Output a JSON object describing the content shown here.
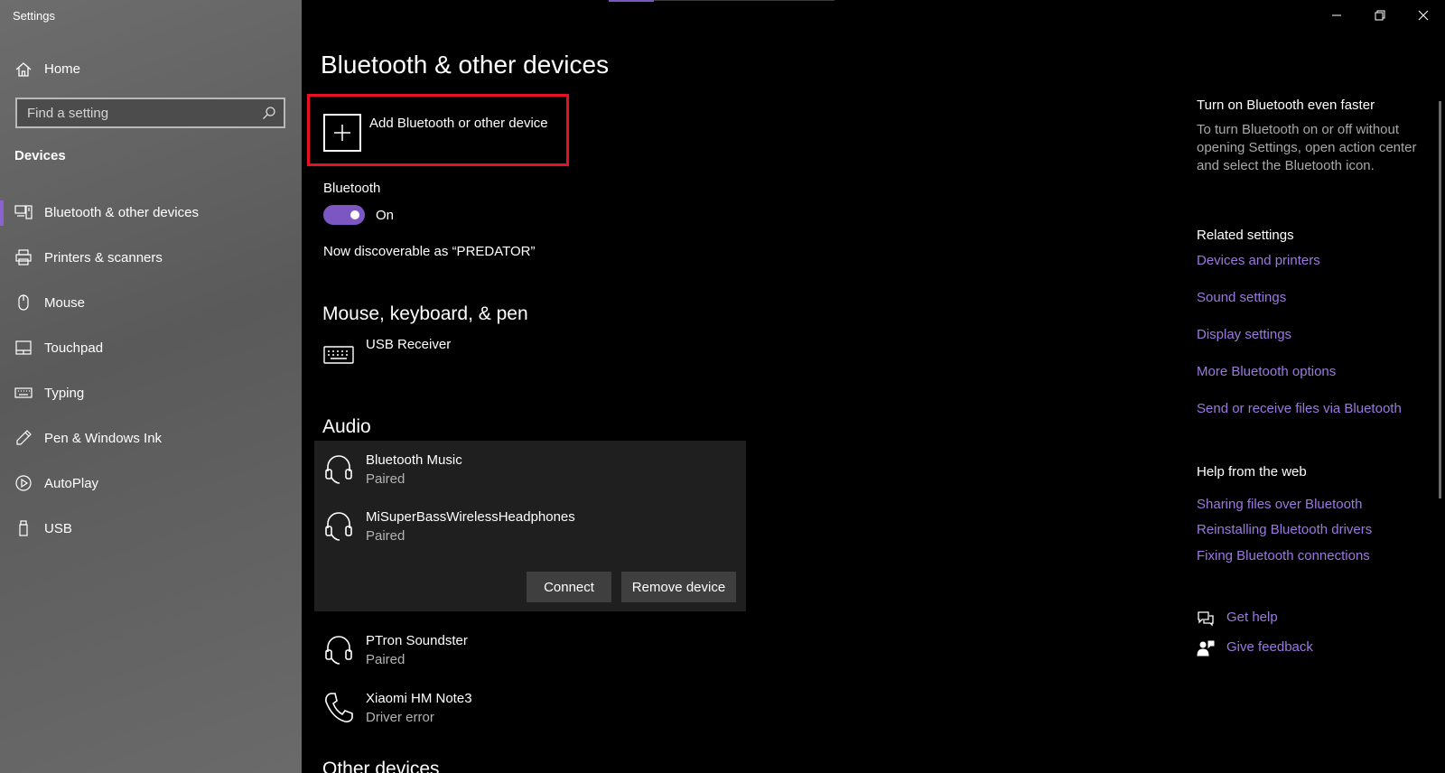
{
  "window": {
    "title": "Settings",
    "controls": [
      "minimize-icon",
      "restore-icon",
      "close-icon"
    ]
  },
  "sidebar": {
    "home_label": "Home",
    "search_placeholder": "Find a setting",
    "section_heading": "Devices",
    "items": [
      {
        "label": "Bluetooth & other devices",
        "icon": "bluetooth-devices-icon",
        "selected": true
      },
      {
        "label": "Printers & scanners",
        "icon": "printer-icon",
        "selected": false
      },
      {
        "label": "Mouse",
        "icon": "mouse-icon",
        "selected": false
      },
      {
        "label": "Touchpad",
        "icon": "touchpad-icon",
        "selected": false
      },
      {
        "label": "Typing",
        "icon": "keyboard-icon",
        "selected": false
      },
      {
        "label": "Pen & Windows Ink",
        "icon": "pen-icon",
        "selected": false
      },
      {
        "label": "AutoPlay",
        "icon": "autoplay-icon",
        "selected": false
      },
      {
        "label": "USB",
        "icon": "usb-icon",
        "selected": false
      }
    ]
  },
  "main": {
    "title": "Bluetooth & other devices",
    "add_device_label": "Add Bluetooth or other device",
    "bluetooth_label": "Bluetooth",
    "bluetooth_state": "On",
    "discoverable_text": "Now discoverable as “PREDATOR”",
    "mouse_group_title": "Mouse, keyboard, & pen",
    "mouse_devices": [
      {
        "name": "USB Receiver",
        "status": "",
        "icon": "keyboard-icon"
      }
    ],
    "audio_group_title": "Audio",
    "audio_devices": [
      {
        "name": "Bluetooth Music",
        "status": "Paired",
        "icon": "headset-icon"
      },
      {
        "name": "MiSuperBassWirelessHeadphones",
        "status": "Paired",
        "icon": "headset-icon"
      },
      {
        "name": "PTron Soundster",
        "status": "Paired",
        "icon": "headset-icon"
      },
      {
        "name": "Xiaomi HM Note3",
        "status": "Driver error",
        "icon": "phone-icon"
      }
    ],
    "connect_label": "Connect",
    "remove_label": "Remove device",
    "other_group_title": "Other devices"
  },
  "right": {
    "faster_heading": "Turn on Bluetooth even faster",
    "faster_text": "To turn Bluetooth on or off without opening Settings, open action center and select the Bluetooth icon.",
    "related_heading": "Related settings",
    "related_links": [
      "Devices and printers",
      "Sound settings",
      "Display settings",
      "More Bluetooth options",
      "Send or receive files via Bluetooth"
    ],
    "help_heading": "Help from the web",
    "help_links": [
      "Sharing files over Bluetooth",
      "Reinstalling Bluetooth drivers",
      "Fixing Bluetooth connections"
    ],
    "get_help": "Get help",
    "give_feedback": "Give feedback"
  },
  "colors": {
    "accent": "#7c57c4",
    "link": "#9c79e0",
    "highlight_border": "#e81123",
    "sidebar_bg": "#5f5f5f",
    "main_bg": "#000000"
  }
}
